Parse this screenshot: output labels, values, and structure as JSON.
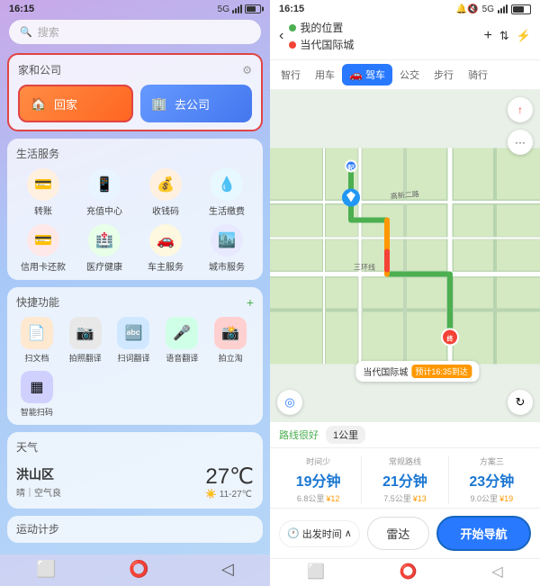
{
  "left": {
    "statusBar": {
      "time": "16:15",
      "signal": "5G",
      "battery": "69%"
    },
    "search": {
      "placeholder": "搜索"
    },
    "jiahegongsi": {
      "title": "家和公司",
      "homeBtn": "回家",
      "companyBtn": "去公司"
    },
    "lifeServices": {
      "title": "生活服务",
      "items": [
        {
          "label": "转账",
          "icon": "💳",
          "color": "#fff0e0"
        },
        {
          "label": "充值中心",
          "icon": "📱",
          "color": "#e8f4ff"
        },
        {
          "label": "收钱码",
          "icon": "💰",
          "color": "#fff0e0"
        },
        {
          "label": "生活缴费",
          "icon": "💧",
          "color": "#e8f8ff"
        },
        {
          "label": "信用卡还款",
          "icon": "💳",
          "color": "#ffe8e8"
        },
        {
          "label": "医疗健康",
          "icon": "🏥",
          "color": "#e8ffe8"
        },
        {
          "label": "车主服务",
          "icon": "🚗",
          "color": "#fff8e0"
        },
        {
          "label": "城市服务",
          "icon": "🏙️",
          "color": "#e8e8ff"
        }
      ]
    },
    "quickFunctions": {
      "title": "快捷功能",
      "addLabel": "+",
      "items": [
        {
          "label": "扫文档",
          "icon": "📄",
          "color": "#ffe8d0"
        },
        {
          "label": "拍照翻译",
          "icon": "📷",
          "color": "#e0e0e0"
        },
        {
          "label": "扫词翻译",
          "icon": "🔤",
          "color": "#d0e8ff"
        },
        {
          "label": "语音翻译",
          "icon": "🎤",
          "color": "#d0ffe8"
        },
        {
          "label": "拍立淘",
          "icon": "📸",
          "color": "#ffd0d0"
        },
        {
          "label": "智能扫码",
          "icon": "▦",
          "color": "#d0d0ff"
        }
      ]
    },
    "weather": {
      "title": "天气",
      "city": "洪山区",
      "temp": "27℃",
      "status": "晴｜空气良",
      "range": "11-27℃"
    },
    "steps": {
      "title": "运动计步"
    },
    "navBar": {
      "items": [
        "⬜",
        "⭕",
        "◁"
      ]
    }
  },
  "right": {
    "statusBar": {
      "time": "16:15",
      "signal": "5G",
      "battery": "69%",
      "icons": "🔔🔇"
    },
    "header": {
      "backLabel": "‹",
      "myLocation": "我的位置",
      "destination": "当代国际城",
      "actions": [
        "+",
        "🔀",
        "⚡"
      ]
    },
    "transportTabs": {
      "items": [
        "智行",
        "用车",
        "驾车",
        "公交",
        "步行",
        "骑行"
      ],
      "activeIndex": 2
    },
    "map": {
      "destinationLabel": "当代国际城",
      "etaLabel": "预计16:35到达",
      "compassLabel": "N",
      "scaleLabel": "1公里",
      "routeQuality": "路线很好"
    },
    "routeOptions": [
      {
        "title": "时间少",
        "time": "19分钟",
        "distance": "6.8公里",
        "cost": "¥12"
      },
      {
        "title": "常规路线",
        "time": "21分钟",
        "distance": "7.5公里",
        "cost": "¥13"
      },
      {
        "title": "方案三",
        "time": "23分钟",
        "distance": "9.0公里",
        "cost": "¥19"
      }
    ],
    "bottomActions": {
      "departTimeLabel": "出发时间",
      "departTimeArrow": "∧",
      "radarLabel": "雷达",
      "startNavLabel": "开始导航"
    },
    "navBar": {
      "items": [
        "⬜",
        "⭕",
        "◁"
      ]
    }
  }
}
